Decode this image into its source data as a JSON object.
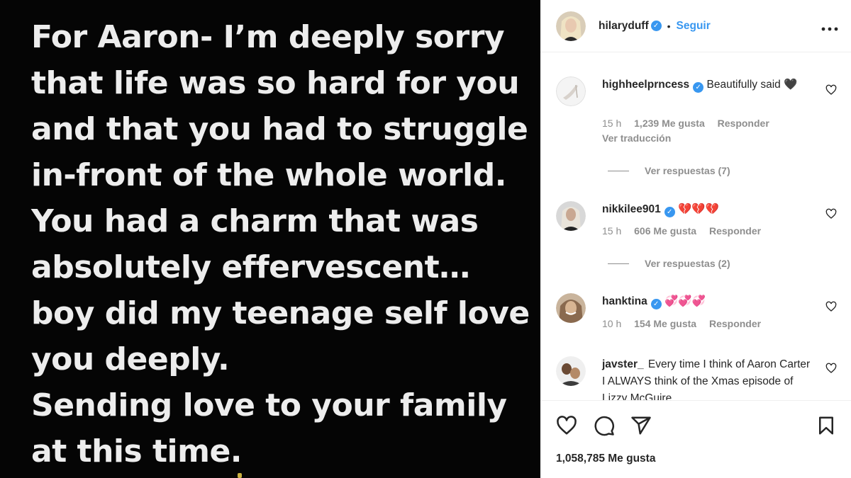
{
  "post": {
    "lines": [
      "For Aaron- I’m deeply sorry",
      "that life was so hard for you",
      "and that you had to struggle",
      "in-front of the whole world.",
      "You had a charm that was",
      "absolutely effervescent…",
      "boy did my teenage self love",
      "you deeply.",
      "Sending love to your family",
      "at this time."
    ]
  },
  "header": {
    "username": "hilaryduff",
    "verified_glyph": "✓",
    "separator": "•",
    "follow_label": "Seguir",
    "more_label": "•••"
  },
  "comments": [
    {
      "username": "highheelprncess",
      "text": "Beautifully said 🖤",
      "time": "15 h",
      "likes": "1,239 Me gusta",
      "reply": "Responder",
      "translate": "Ver traducción",
      "replies": "Ver respuestas (7)"
    },
    {
      "username": "nikkilee901",
      "text": "💔💔💔",
      "time": "15 h",
      "likes": "606 Me gusta",
      "reply": "Responder",
      "replies": "Ver respuestas (2)"
    },
    {
      "username": "hanktina",
      "text": "💞💞💞",
      "time": "10 h",
      "likes": "154 Me gusta",
      "reply": "Responder"
    },
    {
      "username": "javster_",
      "text": "Every time I think of Aaron Carter I ALWAYS think of the Xmas episode of Lizzy McGuire"
    }
  ],
  "footer": {
    "likes_count": "1,058,785 Me gusta"
  },
  "icons": {
    "header_avatar": "avatar-icon",
    "like": "heart-icon",
    "comment": "comment-icon",
    "share": "share-icon",
    "save": "bookmark-icon"
  },
  "colors": {
    "accent": "#3897f0",
    "text": "#262626",
    "muted": "#8e8e8e",
    "post_bg": "#050505",
    "post_text": "#ededed"
  }
}
